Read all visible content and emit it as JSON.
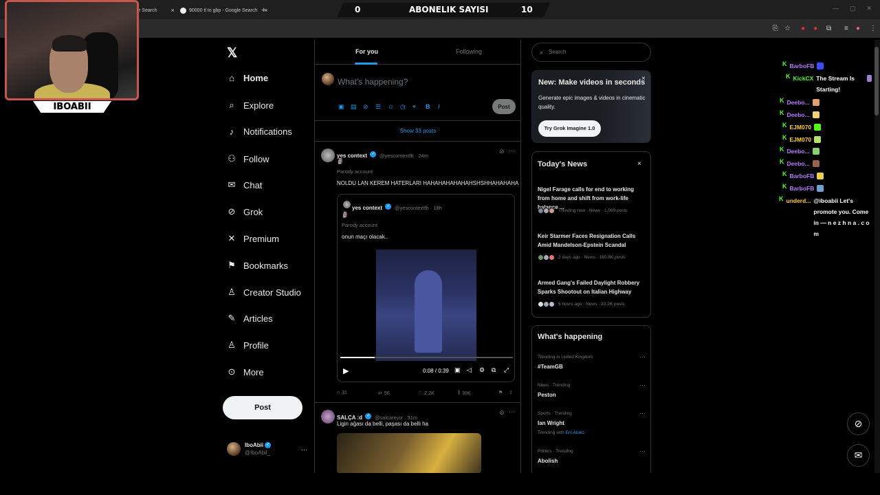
{
  "browser": {
    "tabs": [
      {
        "label": "gle Search"
      },
      {
        "label": "90000 tl to gbp - Google Search"
      }
    ],
    "new_tab_symbol": "+",
    "tab_close_symbol": "×"
  },
  "stream": {
    "sub_left": "0",
    "sub_title": "ABONELIK SAYISI",
    "sub_right": "10",
    "streamer_name": "IBOABII"
  },
  "x_logo": "𝕏",
  "nav": [
    {
      "label": "Home",
      "icon": "home-icon",
      "glyph": "⌂"
    },
    {
      "label": "Explore",
      "icon": "search-icon",
      "glyph": "⌕"
    },
    {
      "label": "Notifications",
      "icon": "bell-icon",
      "glyph": "♪"
    },
    {
      "label": "Follow",
      "icon": "follow-icon",
      "glyph": "⚇"
    },
    {
      "label": "Chat",
      "icon": "mail-icon",
      "glyph": "✉"
    },
    {
      "label": "Grok",
      "icon": "grok-icon",
      "glyph": "⊘"
    },
    {
      "label": "Premium",
      "icon": "x-icon",
      "glyph": "✕"
    },
    {
      "label": "Bookmarks",
      "icon": "bookmark-icon",
      "glyph": "⚑"
    },
    {
      "label": "Creator Studio",
      "icon": "creator-icon",
      "glyph": "♙"
    },
    {
      "label": "Articles",
      "icon": "articles-icon",
      "glyph": "✎"
    },
    {
      "label": "Profile",
      "icon": "profile-icon",
      "glyph": "♙"
    },
    {
      "label": "More",
      "icon": "more-icon",
      "glyph": "⊙"
    }
  ],
  "post_button": "Post",
  "profile": {
    "name": "IboAbii",
    "handle": "@IboAbil_",
    "menu": "···"
  },
  "feed": {
    "tabs": [
      "For you",
      "Following"
    ],
    "composer_placeholder": "What's happening?",
    "composer_post": "Post",
    "show_posts": "Show 33 posts",
    "tweet1": {
      "name": "yes context",
      "handle": "@yescontextfb · 24m",
      "emoji": "🗿",
      "parody": "Parody account",
      "text": "NOLDU LAN KEREM HATERLARI HAHAHAHAHAHAHSHSHHAHAHAHA",
      "quote": {
        "name": "yes context",
        "handle": "@yescontextfb · 18h",
        "emoji": "🗿",
        "parody": "Parody account",
        "text": "onun maçı olacak..",
        "video_time": "0:08 / 0:39",
        "progress": 0.2
      },
      "stats": {
        "replies": "31",
        "reposts": "56",
        "likes": "2.2K",
        "views": "39K"
      }
    },
    "tweet2": {
      "name": "SALÇA :d",
      "handle": "@salcareyiz · 31m",
      "text": "Ligin ağası da belli, paşası da belli ha"
    }
  },
  "right": {
    "search_placeholder": "Search",
    "grok": {
      "title": "New: Make videos in seconds",
      "desc": "Generate epic images & videos in cinematic quality.",
      "button": "Try Grok Imagine 1.0"
    },
    "news": {
      "title": "Today's News",
      "items": [
        {
          "headline": "Nigel Farage calls for end to working from home and shift from work-life balance ...",
          "meta": "Trending now · News · 1,089 posts"
        },
        {
          "headline": "Keir Starmer Faces Resignation Calls Amid Mandelson-Epstein Scandal",
          "meta": "2 days ago · News · 160.8K posts"
        },
        {
          "headline": "Armed Gang's Failed Daylight Robbery Sparks Shootout on Italian Highway",
          "meta": "5 hours ago · News · 23.2K posts"
        }
      ]
    },
    "happening": {
      "title": "What's happening",
      "items": [
        {
          "category": "Trending in United Kingdom",
          "topic": "#TeamGB",
          "extra": ""
        },
        {
          "category": "News · Trending",
          "topic": "Peston",
          "extra": ""
        },
        {
          "category": "Sports · Trending",
          "topic": "Ian Wright",
          "extra": "Trending with",
          "extra_link": "Eni Aluko"
        },
        {
          "category": "Politics · Trending",
          "topic": "Abolish",
          "extra": ""
        }
      ]
    }
  },
  "chat": [
    {
      "user": "BarboFB",
      "color": "#b77bff",
      "msg": "",
      "emote": "#3b4cff"
    },
    {
      "user": "KickCX",
      "color": "#53fc18",
      "msg": "The Stream Is Starting!",
      "emote": "#9f7fd0"
    },
    {
      "user": "Deebo...",
      "color": "#b77bff",
      "msg": "",
      "emote": "#e0a070"
    },
    {
      "user": "Deebo...",
      "color": "#b77bff",
      "msg": "",
      "emote": "#f0d070"
    },
    {
      "user": "EJM070",
      "color": "#ffcc33",
      "msg": "",
      "emote": "#53fc18"
    },
    {
      "user": "EJM070",
      "color": "#ffcc33",
      "msg": "",
      "emote": "#b0e070"
    },
    {
      "user": "Deebo...",
      "color": "#b77bff",
      "msg": "",
      "emote": "#8ad070"
    },
    {
      "user": "Deebo...",
      "color": "#b77bff",
      "msg": "",
      "emote": "#9a6050"
    },
    {
      "user": "BarboFB",
      "color": "#b77bff",
      "msg": "",
      "emote": "#e8d050"
    },
    {
      "user": "BarboFB",
      "color": "#b77bff",
      "msg": "",
      "emote": "#6fa0d0"
    },
    {
      "user": "underd...",
      "color": "#ffcc33",
      "msg": "@iboabii Let's promote you. Come in — n e z h n a . c o m",
      "emote": ""
    }
  ],
  "fab": {
    "grok": "⊘",
    "messages": "✉"
  }
}
